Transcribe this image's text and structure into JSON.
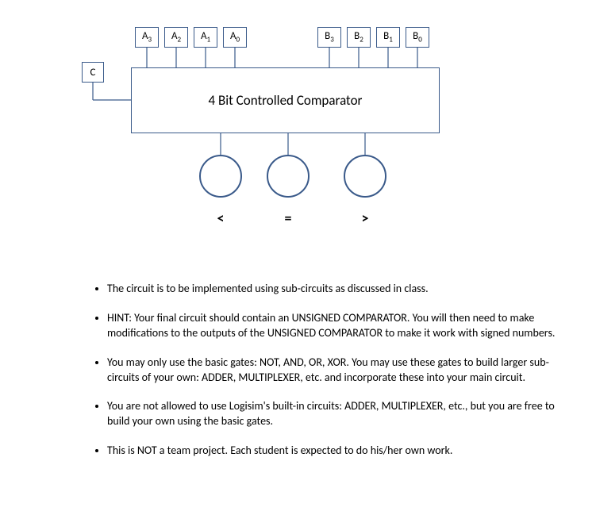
{
  "diagram": {
    "c_label": "C",
    "a_inputs": [
      "A",
      "A",
      "A",
      "A"
    ],
    "a_subs": [
      "3",
      "2",
      "1",
      "0"
    ],
    "b_inputs": [
      "B",
      "B",
      "B",
      "B"
    ],
    "b_subs": [
      "3",
      "2",
      "1",
      "0"
    ],
    "main_title": "4 Bit Controlled Comparator",
    "out_labels": [
      "<",
      "=",
      ">"
    ]
  },
  "bullets": {
    "b0": "The circuit is to be implemented using sub-circuits as discussed in class.",
    "b1": "HINT:  Your final circuit should contain an UNSIGNED COMPARATOR.  You will then need to make modifications to the outputs of the UNSIGNED COMPARATOR to make it work with signed numbers.",
    "b2": "You may only use the basic gates:  NOT, AND, OR, XOR.  You may use these gates to build larger sub-circuits of your own:  ADDER, MULTIPLEXER, etc.  and incorporate these into your main circuit.",
    "b3": "You are not allowed to use Logisim's built-in circuits:  ADDER, MULTIPLEXER, etc., but you are free to build your own using the basic gates.",
    "b4": "This is NOT a team project.  Each student is expected to do his/her own work."
  }
}
